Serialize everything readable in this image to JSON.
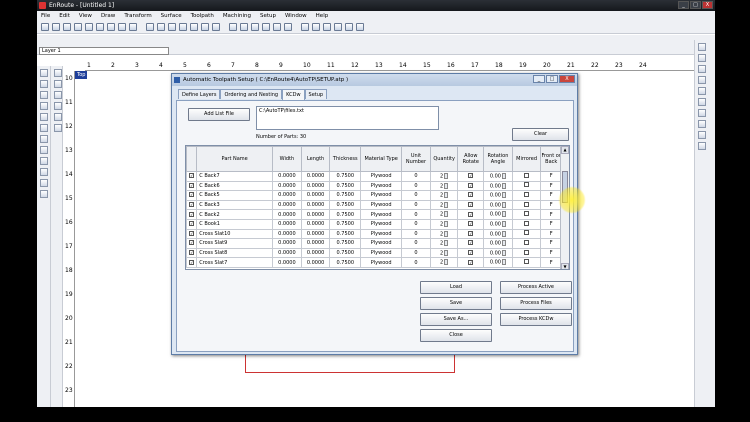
{
  "app": {
    "title": "EnRoute - [Untitled 1]",
    "window_buttons": [
      "_",
      "□",
      "X"
    ],
    "menu": [
      "File",
      "Edit",
      "View",
      "Draw",
      "Transform",
      "Surface",
      "Toolpath",
      "Machining",
      "Setup",
      "Window",
      "Help"
    ],
    "layer_value": "Layer 1",
    "top_view_tag": "Top",
    "ruler_ticks": [
      "1",
      "2",
      "3",
      "4",
      "5",
      "6",
      "7",
      "8",
      "9",
      "10",
      "11",
      "12",
      "13",
      "14",
      "15",
      "16",
      "17",
      "18",
      "19",
      "20",
      "21",
      "22",
      "23",
      "24"
    ],
    "vruler_ticks": [
      "10",
      "11",
      "12",
      "13",
      "14",
      "15",
      "16",
      "17",
      "18",
      "19",
      "20",
      "21",
      "22",
      "23"
    ]
  },
  "dialog": {
    "title": "Automatic Toolpath Setup ( C:\\EnRoute4\\AutoTP\\SETUP.atp )",
    "buttons": [
      "_",
      "□",
      "X"
    ],
    "tabs": [
      "Define Layers",
      "Ordering and Nesting",
      "KCDw",
      "Setup"
    ],
    "active_tab": "KCDw",
    "add_list_file": "Add List File",
    "path_value": "C:\\AutoTP\\files.txt",
    "number_of_parts_label": "Number of Parts:",
    "number_of_parts": "30",
    "clear": "Clear",
    "columns": [
      "",
      "Part Name",
      "Width",
      "Length",
      "Thickness",
      "Material Type",
      "Unit Number",
      "Quantity",
      "Allow Rotate",
      "Rotation Angle",
      "Mirrored",
      "Front or Back"
    ],
    "rows": [
      {
        "name": "C Back7",
        "width": "0.0000",
        "length": "0.0000",
        "thickness": "0.7500",
        "material": "Plywood",
        "unit": "0",
        "qty": "2",
        "rot_angle": "0.00",
        "side": "F"
      },
      {
        "name": "C Back6",
        "width": "0.0000",
        "length": "0.0000",
        "thickness": "0.7500",
        "material": "Plywood",
        "unit": "0",
        "qty": "2",
        "rot_angle": "0.00",
        "side": "F"
      },
      {
        "name": "C Back5",
        "width": "0.0000",
        "length": "0.0000",
        "thickness": "0.7500",
        "material": "Plywood",
        "unit": "0",
        "qty": "2",
        "rot_angle": "0.00",
        "side": "F"
      },
      {
        "name": "C Back3",
        "width": "0.0000",
        "length": "0.0000",
        "thickness": "0.7500",
        "material": "Plywood",
        "unit": "0",
        "qty": "2",
        "rot_angle": "0.00",
        "side": "F"
      },
      {
        "name": "C Back2",
        "width": "0.0000",
        "length": "0.0000",
        "thickness": "0.7500",
        "material": "Plywood",
        "unit": "0",
        "qty": "2",
        "rot_angle": "0.00",
        "side": "F"
      },
      {
        "name": "C Book1",
        "width": "0.0000",
        "length": "0.0000",
        "thickness": "0.7500",
        "material": "Plywood",
        "unit": "0",
        "qty": "2",
        "rot_angle": "0.00",
        "side": "F"
      },
      {
        "name": "Cross Slat10",
        "width": "0.0000",
        "length": "0.0000",
        "thickness": "0.7500",
        "material": "Plywood",
        "unit": "0",
        "qty": "2",
        "rot_angle": "0.00",
        "side": "F"
      },
      {
        "name": "Cross Slat9",
        "width": "0.0000",
        "length": "0.0000",
        "thickness": "0.7500",
        "material": "Plywood",
        "unit": "0",
        "qty": "2",
        "rot_angle": "0.00",
        "side": "F"
      },
      {
        "name": "Cross Slat8",
        "width": "0.0000",
        "length": "0.0000",
        "thickness": "0.7500",
        "material": "Plywood",
        "unit": "0",
        "qty": "2",
        "rot_angle": "0.00",
        "side": "F"
      },
      {
        "name": "Cross Slat7",
        "width": "0.0000",
        "length": "0.0000",
        "thickness": "0.7500",
        "material": "Plywood",
        "unit": "0",
        "qty": "2",
        "rot_angle": "0.00",
        "side": "F"
      }
    ],
    "check_mark": "✓",
    "actions": {
      "load": "Load",
      "save": "Save",
      "save_as": "Save As...",
      "close": "Close",
      "process_active": "Process Active",
      "process_files": "Process Files",
      "process_kcdw": "Process KCDw"
    }
  }
}
